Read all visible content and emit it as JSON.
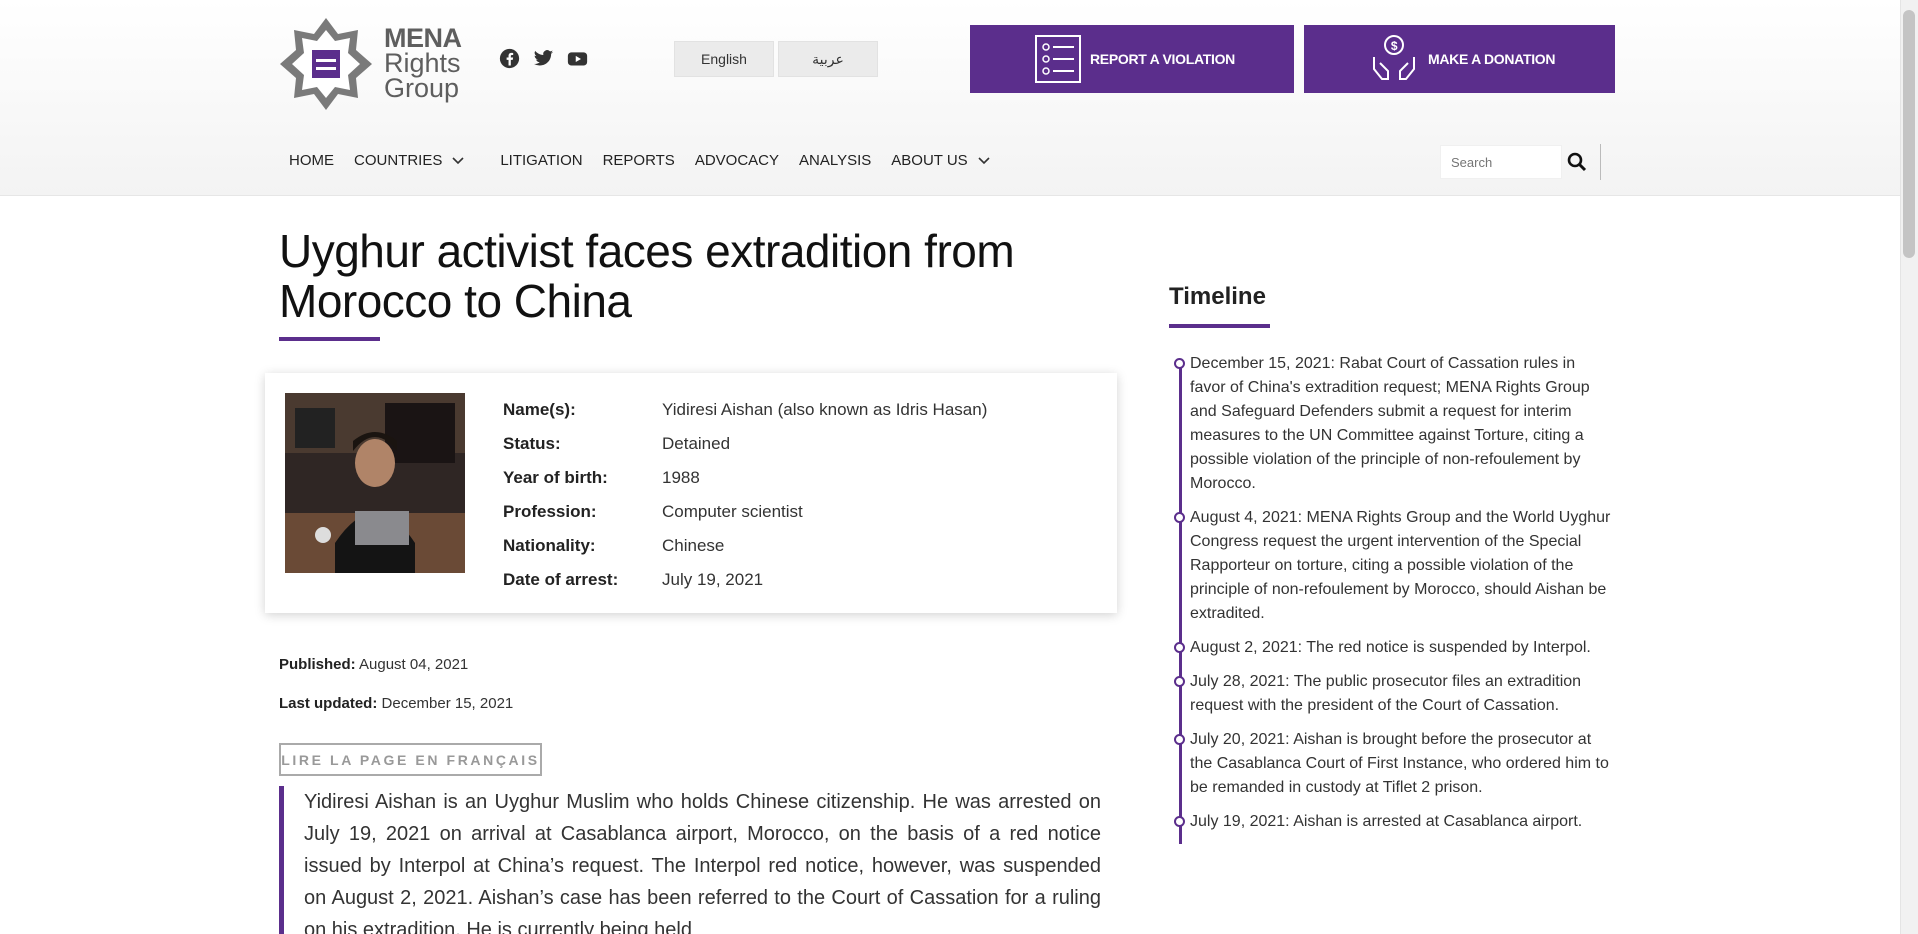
{
  "header": {
    "logo_lines": [
      "MENA",
      "Rights",
      "Group"
    ],
    "social_icons": [
      "facebook-icon",
      "twitter-icon",
      "youtube-icon"
    ],
    "languages": [
      "English",
      "عربية"
    ],
    "report_label": "REPORT A VIOLATION",
    "donate_label": "MAKE A DONATION",
    "brand_color": "#5b2e8c"
  },
  "nav": {
    "items": [
      "HOME",
      "COUNTRIES",
      "LITIGATION",
      "REPORTS",
      "ADVOCACY",
      "ANALYSIS",
      "ABOUT US"
    ],
    "search_placeholder": "Search"
  },
  "article": {
    "title": "Uyghur activist faces extradition from Morocco to China",
    "profile": [
      {
        "label": "Name(s):",
        "value": "Yidiresi Aishan (also known as Idris Hasan)"
      },
      {
        "label": "Status:",
        "value": "Detained"
      },
      {
        "label": "Year of birth:",
        "value": "1988"
      },
      {
        "label": "Profession:",
        "value": "Computer scientist"
      },
      {
        "label": "Nationality:",
        "value": "Chinese"
      },
      {
        "label": "Date of arrest:",
        "value": "July 19, 2021"
      }
    ],
    "published_label": "Published:",
    "published": "August 04, 2021",
    "updated_label": "Last updated:",
    "updated": "December 15, 2021",
    "french_link": "LIRE LA PAGE EN FRANÇAIS",
    "summary": "Yidiresi Aishan is an Uyghur Muslim who holds Chinese citizenship. He was arrested on July 19, 2021 on arrival at Casablanca airport, Morocco, on the basis of a red notice issued by Interpol at China’s request. The Interpol red notice, however, was suspended on August 2, 2021. Aishan’s case has been referred to the Court of Cassation for a ruling on his extradition. He is currently being held"
  },
  "timeline": {
    "title": "Timeline",
    "items": [
      "December 15, 2021: Rabat Court of Cassation rules in favor of China's extradition request; MENA Rights Group and Safeguard Defenders submit a request for interim measures to the UN Committee against Torture, citing a possible violation of the principle of non-refoulement by Morocco.",
      "August 4, 2021: MENA Rights Group and the World Uyghur Congress request the urgent intervention of the Special Rapporteur on torture, citing a possible violation of the principle of non-refoulement by Morocco, should Aishan be extradited.",
      "August 2, 2021: The red notice is suspended by Interpol.",
      "July 28, 2021: The public prosecutor files an extradition request with the president of the Court of Cassation.",
      "July 20, 2021: Aishan is brought before the prosecutor at the Casablanca Court of First Instance, who ordered him to be remanded in custody at Tiflet 2 prison.",
      "July 19, 2021: Aishan is arrested at Casablanca airport."
    ]
  }
}
